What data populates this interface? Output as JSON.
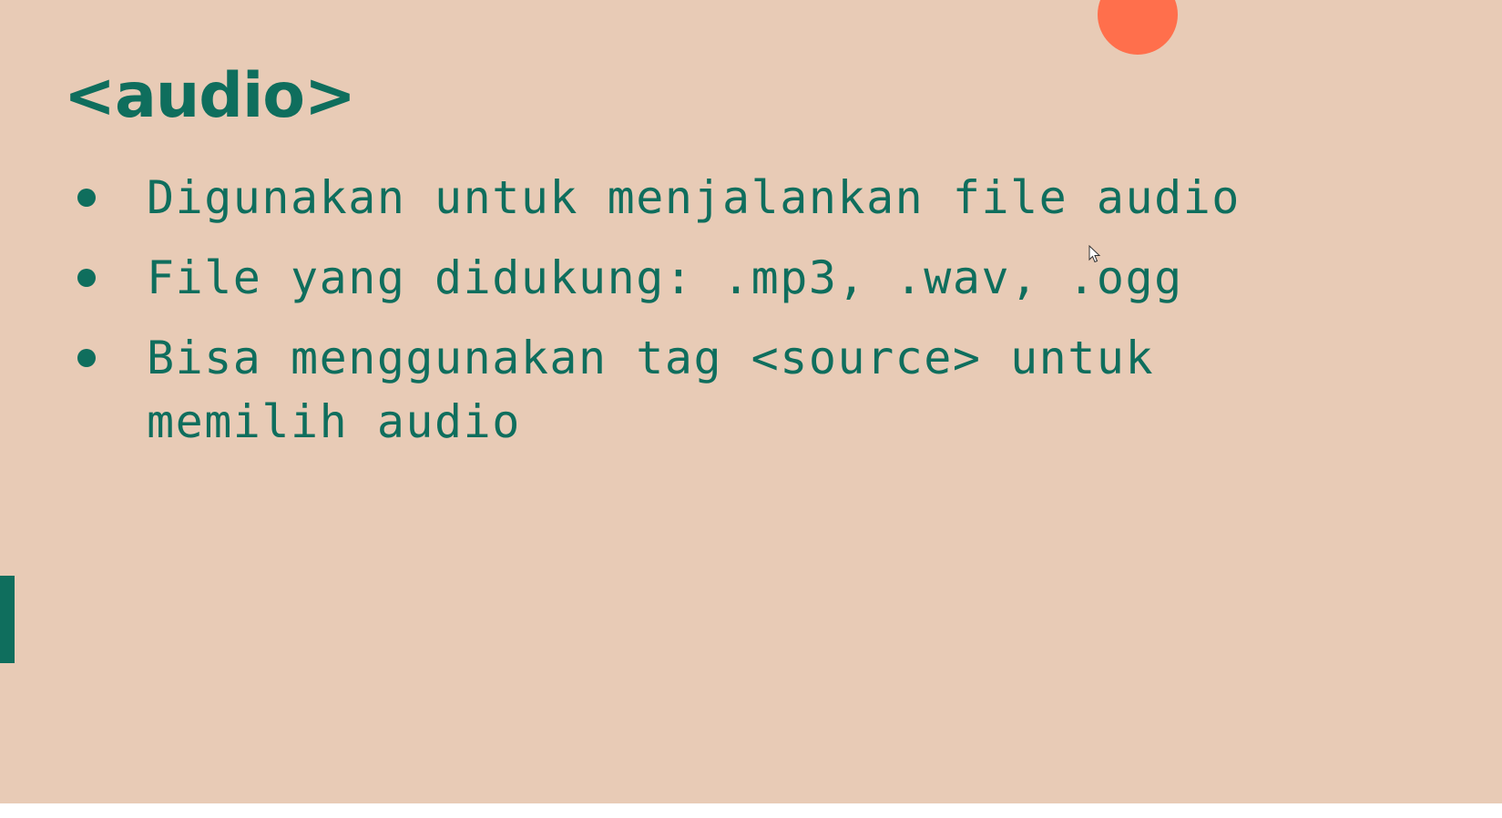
{
  "slide": {
    "title": "<audio>",
    "bullets": [
      {
        "text": "Digunakan untuk menjalankan file audio"
      },
      {
        "text": "File yang didukung: .mp3, .wav, .ogg"
      },
      {
        "text": "Bisa menggunakan tag <source> untuk memilih audio"
      }
    ]
  },
  "colors": {
    "background": "#e8cbb6",
    "primary": "#0f6e5d",
    "accent": "#ff6f4c"
  },
  "icons": {
    "cursor": "mouse-pointer-icon"
  }
}
